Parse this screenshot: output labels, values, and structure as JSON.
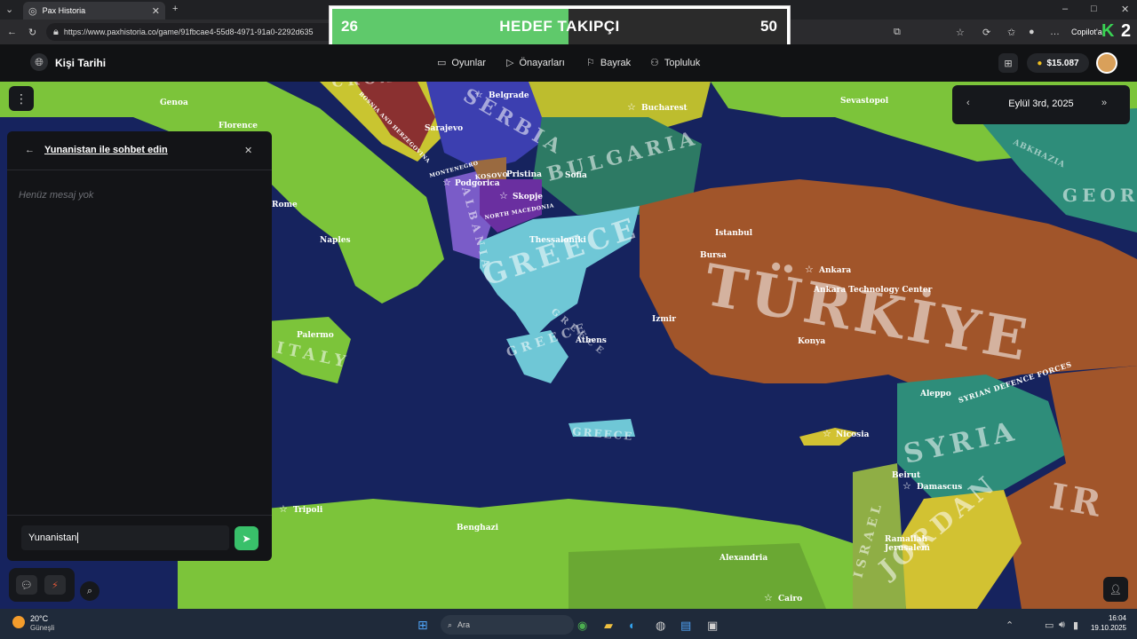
{
  "browser": {
    "tab_title": "Pax Historia",
    "url": "https://www.paxhistoria.co/game/91fbcae4-55d8-4971-91a0-2292d635",
    "copilot": "Copilot'a"
  },
  "tracker": {
    "left_value": "26",
    "title": "HEDEF TAKIPÇI",
    "right_value": "50",
    "progress": 0.52
  },
  "header": {
    "brand": "Kişi Tarihi",
    "nav": [
      "Oyunlar",
      "Önayarları",
      "Bayrak",
      "Topluluk"
    ],
    "coins": "$15.087"
  },
  "date_widget": {
    "date": "Eylül 3rd, 2025"
  },
  "chat": {
    "title": "Yunanistan ile sohbet edin",
    "empty": "Henüz mesaj yok",
    "input_value": "Yunanistan"
  },
  "map": {
    "countries": [
      "GREECE",
      "BULGARIA",
      "TÜRKİYE",
      "ITALY",
      "SYRIA",
      "JORDAN",
      "SERBIA",
      "ALBANIA",
      "CROATIA",
      "ISRAEL",
      "GREECE",
      "GREECE",
      "GEOR",
      "ABKHAZIA",
      "NORTH MACEDONIA",
      "KOSOVO",
      "MONTENEGRO",
      "BOSNIA AND HERZEGOVINA",
      "SYRIAN DEFENCE FORCES",
      "GREECE",
      "IR"
    ],
    "cities": [
      "Belgrade",
      "Bucharest",
      "Sevastopol",
      "Sarajevo",
      "Podgorica",
      "Pristina",
      "Sofia",
      "Skopje",
      "Thessaloniki",
      "Istanbul",
      "Bursa",
      "Ankara",
      "Ankara Technology Center",
      "Izmir",
      "Konya",
      "Athens",
      "Naples",
      "Rome",
      "Palermo",
      "Nicosia",
      "Aleppo",
      "Damascus",
      "Beirut",
      "Tripoli",
      "Benghazi",
      "Alexandria",
      "Cairo",
      "Jerusalem",
      "Ramallah",
      "Genoa",
      "Florence"
    ]
  },
  "taskbar": {
    "weather_temp": "20°C",
    "weather_label": "Güneşli",
    "search": "Ara",
    "time": "16:04",
    "date": "19.10.2025"
  },
  "colors": {
    "sea": "#16235e",
    "greece": "#6fc7d6",
    "turkey": "#a1552a",
    "italy": "#7cc43a",
    "bulgaria": "#2d7a64",
    "syria": "#2e8d7a",
    "jordan": "#d2c232",
    "send_button": "#39c06a",
    "tracker_fill": "#5fc96b"
  }
}
